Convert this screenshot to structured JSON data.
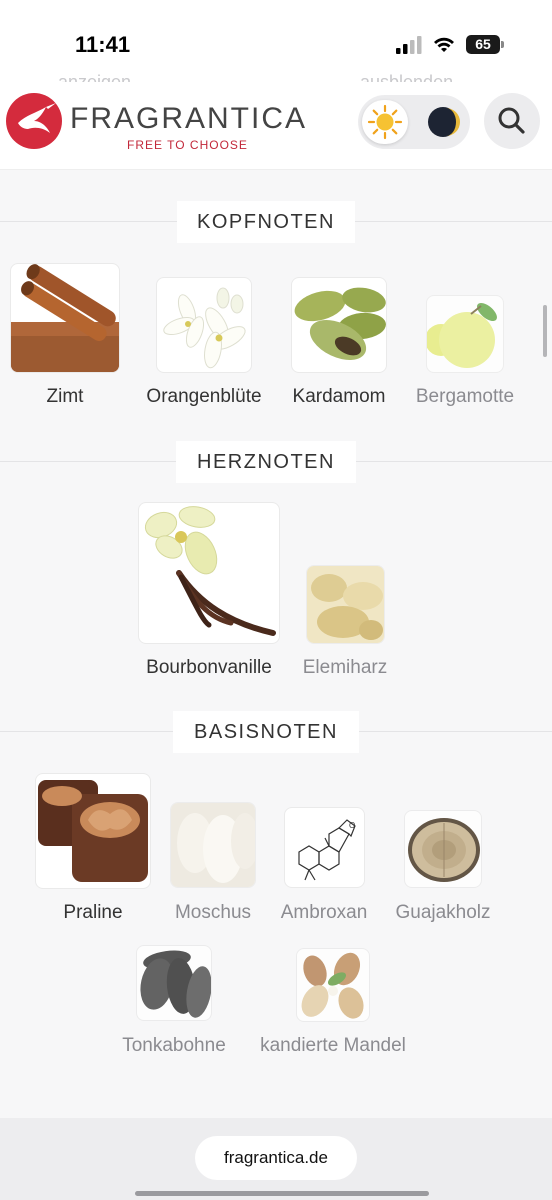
{
  "status": {
    "time": "11:41",
    "battery": "65"
  },
  "header_ghost": {
    "left": "anzeigen",
    "right": "ausblenden"
  },
  "logo": {
    "name": "FRAGRANTICA",
    "tagline": "FREE TO CHOOSE"
  },
  "site_url": "fragrantica.de",
  "sections": {
    "top": {
      "title": "KOPFNOTEN",
      "notes": [
        "Zimt",
        "Orangenblüte",
        "Kardamom",
        "Bergamotte"
      ]
    },
    "heart": {
      "title": "HERZNOTEN",
      "notes": [
        "Bourbonvanille",
        "Elemiharz"
      ]
    },
    "base": {
      "title": "BASISNOTEN",
      "notes": [
        "Praline",
        "Moschus",
        "Ambroxan",
        "Guajakholz",
        "Tonkabohne",
        "kandierte Mandel"
      ]
    }
  },
  "icons": {
    "logo": "hummingbird-icon",
    "theme_light": "sun-icon",
    "theme_dark": "moon-icon",
    "search": "search-icon"
  },
  "colors": {
    "brand": "#d42b3d",
    "text": "#333333",
    "faded_text": "#8b8b90"
  }
}
